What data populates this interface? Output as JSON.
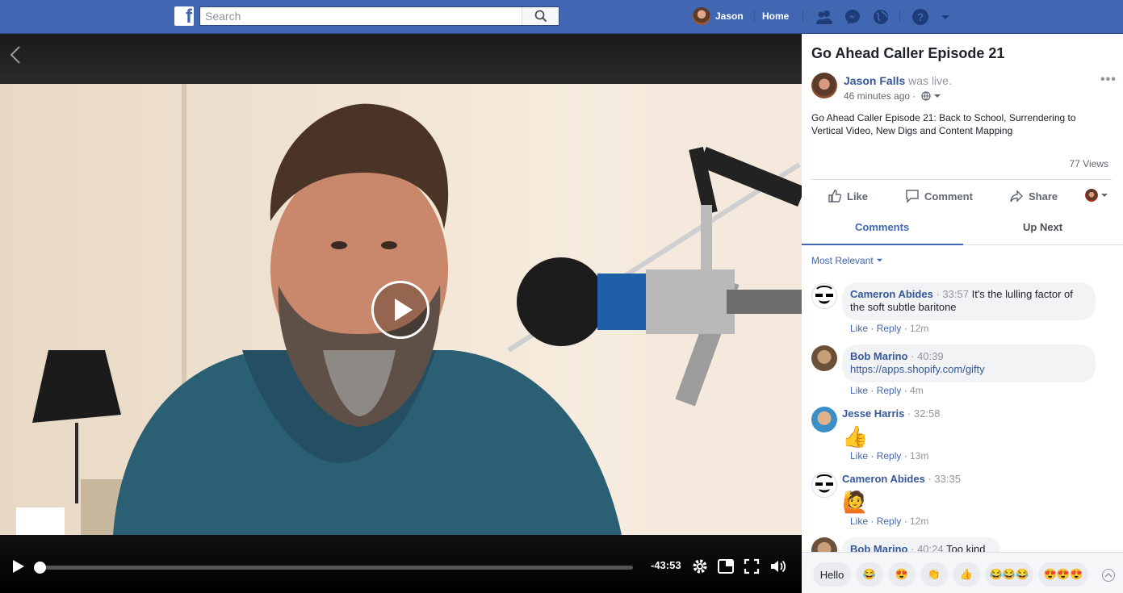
{
  "topbar": {
    "search_placeholder": "Search",
    "user_name": "Jason",
    "home_label": "Home",
    "icons": [
      "friends-icon",
      "messenger-icon",
      "globe-icon",
      "help-icon",
      "dropdown-icon"
    ]
  },
  "video": {
    "time_remaining": "-43:53",
    "progress_fraction": 0.0
  },
  "post": {
    "title": "Go Ahead Caller Episode 21",
    "author": "Jason Falls",
    "live_text": "was live.",
    "posted": "46 minutes ago ·",
    "description": "Go Ahead Caller Episode 21: Back to School, Surrendering to Vertical Video, New Digs and Content Mapping",
    "views": "77 Views",
    "actions": {
      "like": "Like",
      "comment": "Comment",
      "share": "Share"
    }
  },
  "tabs": {
    "comments": "Comments",
    "up_next": "Up Next"
  },
  "sort_label": "Most Relevant",
  "comments": [
    {
      "name": "Cameron Abides",
      "time": "33:57",
      "text": "It's the lulling factor of the soft subtle baritone",
      "like": "Like",
      "reply": "Reply",
      "age": "12m"
    },
    {
      "name": "Bob Marino",
      "time": "40:39",
      "text": "https://apps.shopify.com/gifty",
      "like": "Like",
      "reply": "Reply",
      "age": "4m"
    },
    {
      "name": "Jesse Harris",
      "time": "32:58",
      "text": "👍",
      "like": "Like",
      "reply": "Reply",
      "age": "13m"
    },
    {
      "name": "Cameron Abides",
      "time": "33:35",
      "text": "🙋",
      "like": "Like",
      "reply": "Reply",
      "age": "12m"
    },
    {
      "name": "Bob Marino",
      "time": "40:24",
      "text": "Too kind"
    }
  ],
  "quick_replies": [
    "Hello",
    "😂",
    "😍",
    "👏",
    "👍",
    "😂😂😂",
    "😍😍😍"
  ],
  "colors": {
    "brand": "#4267b2",
    "link": "#365899",
    "panel_bg": "#ffffff"
  }
}
